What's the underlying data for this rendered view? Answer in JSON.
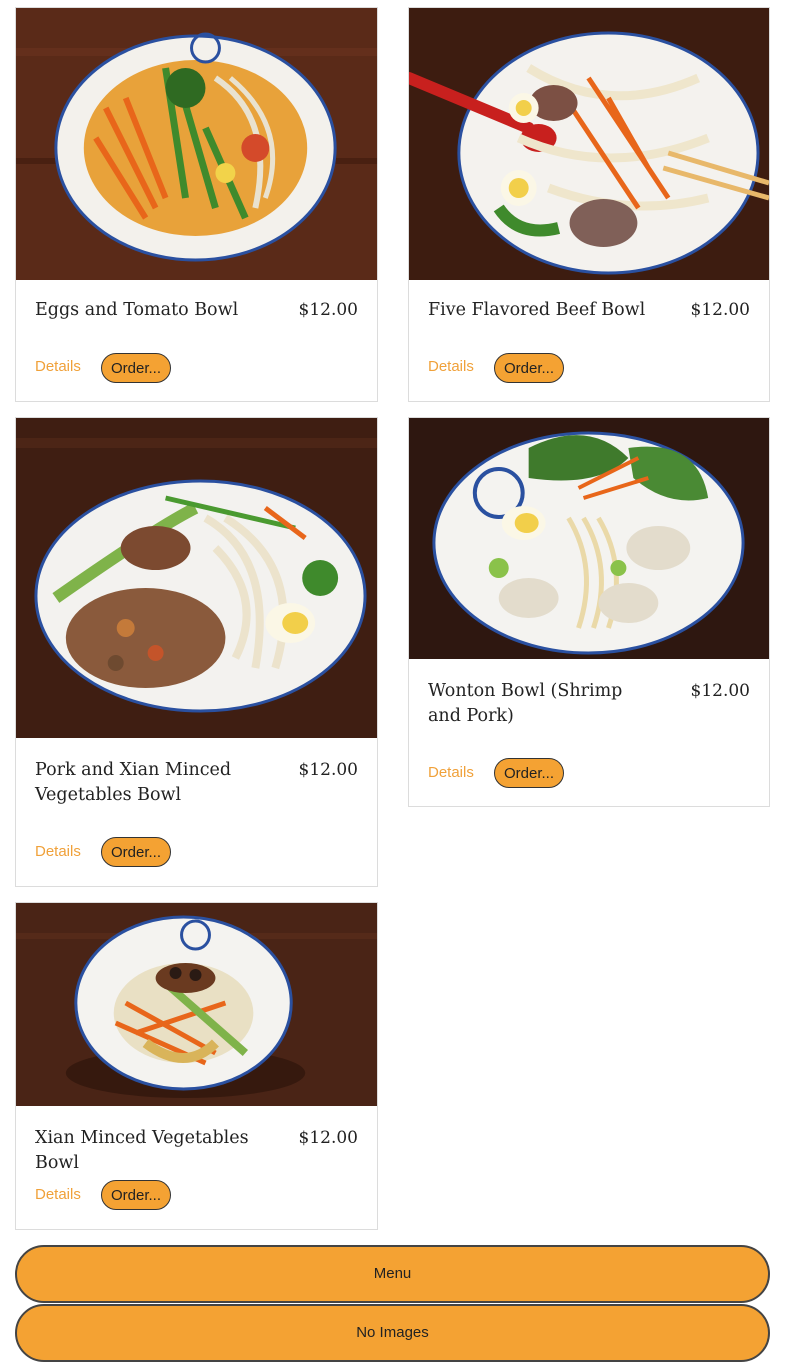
{
  "menu_items": [
    {
      "name": "Eggs and Tomato Bowl",
      "price": "$12.00",
      "details_label": "Details",
      "order_label": "Order..."
    },
    {
      "name": "Five Flavored Beef Bowl",
      "price": "$12.00",
      "details_label": "Details",
      "order_label": "Order..."
    },
    {
      "name": "Pork and Xian Minced Vegetables Bowl",
      "price": "$12.00",
      "details_label": "Details",
      "order_label": "Order..."
    },
    {
      "name": "Wonton Bowl (Shrimp and Pork)",
      "price": "$12.00",
      "details_label": "Details",
      "order_label": "Order..."
    },
    {
      "name": "Xian Minced Vegetables Bowl",
      "price": "$12.00",
      "details_label": "Details",
      "order_label": "Order..."
    }
  ],
  "footer": {
    "menu_label": "Menu",
    "no_images_label": "No Images"
  },
  "colors": {
    "accent": "#f4a233",
    "details_link": "#f0a13a",
    "table_wood": "#4a2416"
  }
}
